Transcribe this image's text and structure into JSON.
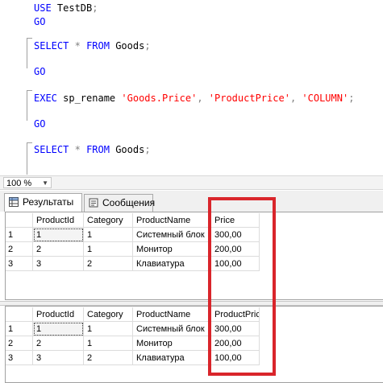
{
  "editor": {
    "lines": [
      {
        "parts": [
          {
            "t": "USE",
            "c": "kw"
          },
          {
            "t": " TestDB",
            "c": ""
          },
          {
            "t": ";",
            "c": "op"
          }
        ]
      },
      {
        "parts": [
          {
            "t": "GO",
            "c": "kw"
          }
        ]
      },
      {
        "parts": [
          {
            "t": "SELECT",
            "c": "kw"
          },
          {
            "t": " ",
            "c": ""
          },
          {
            "t": "*",
            "c": "op"
          },
          {
            "t": " ",
            "c": ""
          },
          {
            "t": "FROM",
            "c": "kw"
          },
          {
            "t": " Goods",
            "c": ""
          },
          {
            "t": ";",
            "c": "op"
          }
        ]
      },
      {
        "parts": [
          {
            "t": "GO",
            "c": "kw"
          }
        ]
      },
      {
        "parts": [
          {
            "t": "EXEC",
            "c": "kw"
          },
          {
            "t": " sp_rename ",
            "c": ""
          },
          {
            "t": "'Goods.Price'",
            "c": "str"
          },
          {
            "t": ",",
            "c": "op"
          },
          {
            "t": " ",
            "c": ""
          },
          {
            "t": "'ProductPrice'",
            "c": "str"
          },
          {
            "t": ",",
            "c": "op"
          },
          {
            "t": " ",
            "c": ""
          },
          {
            "t": "'COLUMN'",
            "c": "str"
          },
          {
            "t": ";",
            "c": "op"
          }
        ]
      },
      {
        "parts": [
          {
            "t": "GO",
            "c": "kw"
          }
        ]
      },
      {
        "parts": [
          {
            "t": "SELECT",
            "c": "kw"
          },
          {
            "t": " ",
            "c": ""
          },
          {
            "t": "*",
            "c": "op"
          },
          {
            "t": " ",
            "c": ""
          },
          {
            "t": "FROM",
            "c": "kw"
          },
          {
            "t": " Goods",
            "c": ""
          },
          {
            "t": ";",
            "c": "op"
          }
        ]
      }
    ]
  },
  "zoom": {
    "value": "100 %"
  },
  "tabs": [
    {
      "label": "Результаты",
      "icon": "grid-icon",
      "active": true
    },
    {
      "label": "Сообщения",
      "icon": "messages-icon",
      "active": false
    }
  ],
  "grids": [
    {
      "columns": [
        "ProductId",
        "Category",
        "ProductName",
        "Price"
      ],
      "rows": [
        {
          "num": "1",
          "cells": [
            "1",
            "1",
            "Системный блок",
            "300,00"
          ]
        },
        {
          "num": "2",
          "cells": [
            "2",
            "1",
            "Монитор",
            "200,00"
          ]
        },
        {
          "num": "3",
          "cells": [
            "3",
            "2",
            "Клавиатура",
            "100,00"
          ]
        }
      ]
    },
    {
      "columns": [
        "ProductId",
        "Category",
        "ProductName",
        "ProductPrice"
      ],
      "rows": [
        {
          "num": "1",
          "cells": [
            "1",
            "1",
            "Системный блок",
            "300,00"
          ]
        },
        {
          "num": "2",
          "cells": [
            "2",
            "1",
            "Монитор",
            "200,00"
          ]
        },
        {
          "num": "3",
          "cells": [
            "3",
            "2",
            "Клавиатура",
            "100,00"
          ]
        }
      ]
    }
  ],
  "colors": {
    "highlight": "#d9252b",
    "keyword": "#0000ff",
    "string": "#ff0000"
  }
}
